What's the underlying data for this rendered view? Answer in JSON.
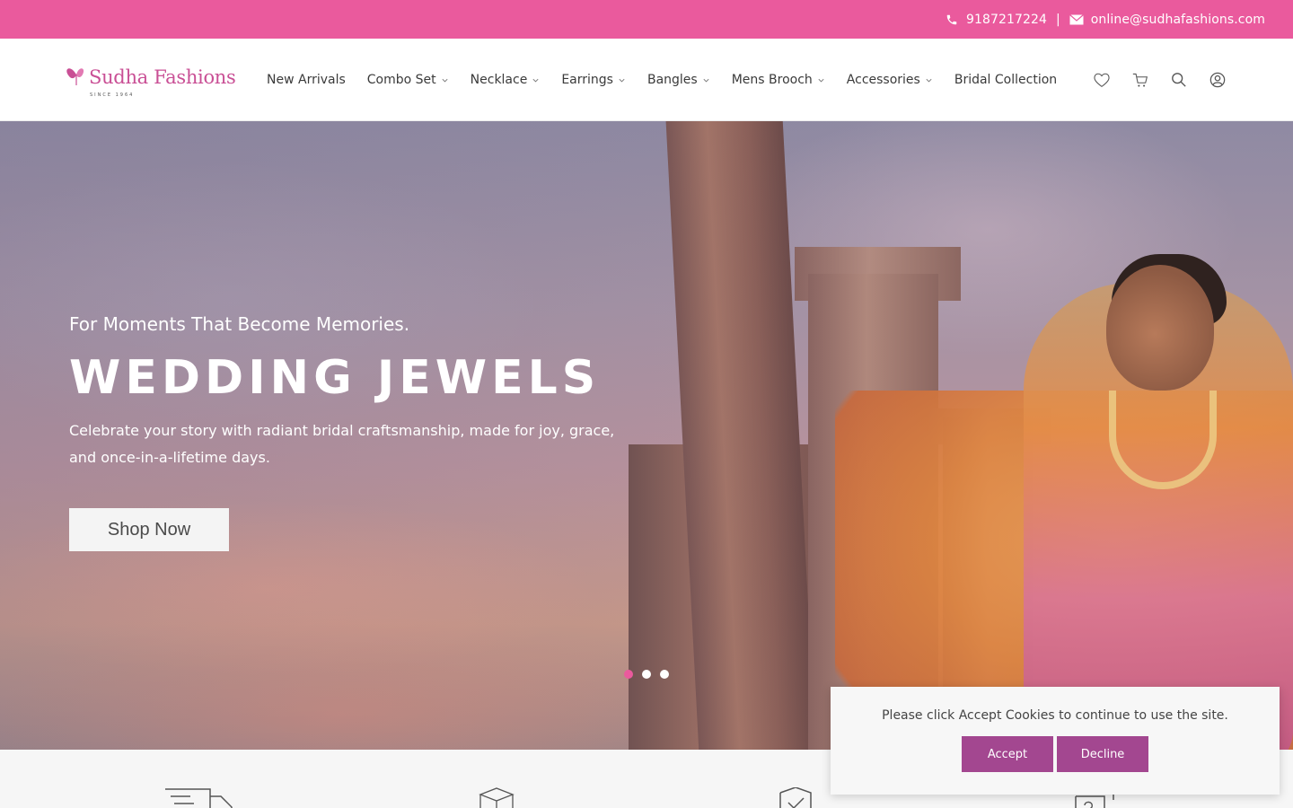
{
  "topbar": {
    "phone": "9187217224",
    "separator": "|",
    "email": "online@sudhafashions.com"
  },
  "brand": {
    "name": "Sudha Fashions",
    "since": "SINCE 1964",
    "color": "#c94f95"
  },
  "nav": {
    "items": [
      {
        "label": "New Arrivals",
        "dropdown": false
      },
      {
        "label": "Combo Set",
        "dropdown": true
      },
      {
        "label": "Necklace",
        "dropdown": true
      },
      {
        "label": "Earrings",
        "dropdown": true
      },
      {
        "label": "Bangles",
        "dropdown": true
      },
      {
        "label": "Mens Brooch",
        "dropdown": true
      },
      {
        "label": "Accessories",
        "dropdown": true
      },
      {
        "label": "Bridal Collection",
        "dropdown": false
      }
    ]
  },
  "header_icons": [
    "heart-icon",
    "cart-icon",
    "search-icon",
    "user-icon"
  ],
  "hero": {
    "subtitle": "For Moments That Become Memories.",
    "title": "WEDDING JEWELS",
    "description": "Celebrate your story with radiant bridal craftsmanship, made for joy, grace, and once-in-a-lifetime days.",
    "button": "Shop Now",
    "slides": 3,
    "active_slide": 1
  },
  "features": [
    "truck-icon",
    "box-icon",
    "shield-check-icon",
    "return-box-icon"
  ],
  "cookie": {
    "message": "Please click Accept Cookies to continue to use the site.",
    "accept": "Accept",
    "decline": "Decline"
  },
  "colors": {
    "accent": "#ea5a9d",
    "cookie_button": "#a34790"
  }
}
